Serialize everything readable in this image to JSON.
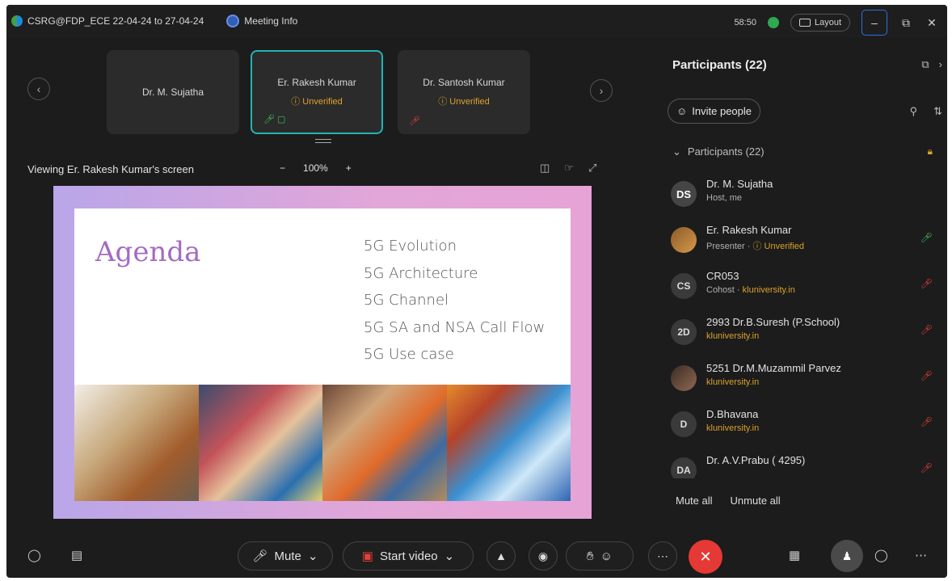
{
  "titlebar": {
    "meeting_name": "CSRG@FDP_ECE 22-04-24 to 27-04-24",
    "meeting_info": "Meeting Info",
    "timer": "58:50",
    "layout_label": "Layout"
  },
  "video_strip": {
    "tiles": [
      {
        "name": "Dr. M. Sujatha",
        "status": ""
      },
      {
        "name": "Er. Rakesh Kumar",
        "status": "ⓘ Unverified"
      },
      {
        "name": "Dr. Santosh Kumar",
        "status": "ⓘ Unverified"
      }
    ]
  },
  "viewbar": {
    "viewing_text": "Viewing Er. Rakesh Kumar's screen",
    "zoom_level": "100%",
    "zoom_out": "−",
    "zoom_in": "+"
  },
  "slide": {
    "title": "Agenda",
    "items": [
      "5G Evolution",
      "5G Architecture",
      "5G Channel",
      "5G SA and NSA Call Flow",
      "5G Use case"
    ]
  },
  "panel": {
    "title": "Participants (22)",
    "invite_label": "Invite people",
    "section_label": "Participants (22)",
    "participants": [
      {
        "initials": "DS",
        "name": "Dr. M. Sujatha",
        "sub": "Host, me",
        "sub_extra": "",
        "status": ""
      },
      {
        "initials": "",
        "name": "Er. Rakesh Kumar",
        "sub": "Presenter · ",
        "sub_extra": "ⓘ Unverified",
        "status": "on"
      },
      {
        "initials": "CS",
        "name": "CR053",
        "sub": "Cohost · ",
        "sub_extra": "kluniversity.in",
        "status": "off"
      },
      {
        "initials": "2D",
        "name": "2993 Dr.B.Suresh (P.School)",
        "sub": "",
        "sub_extra": "kluniversity.in",
        "status": "off"
      },
      {
        "initials": "",
        "name": "5251 Dr.M.Muzammil Parvez",
        "sub": "",
        "sub_extra": "kluniversity.in",
        "status": "off"
      },
      {
        "initials": "D",
        "name": "D.Bhavana",
        "sub": "",
        "sub_extra": "kluniversity.in",
        "status": "off"
      },
      {
        "initials": "DA",
        "name": "Dr. A.V.Prabu ( 4295)",
        "sub": "",
        "sub_extra": "",
        "status": "off"
      }
    ],
    "mute_all": "Mute all",
    "unmute_all": "Unmute all"
  },
  "bottombar": {
    "mute_label": "Mute",
    "video_label": "Start video"
  }
}
